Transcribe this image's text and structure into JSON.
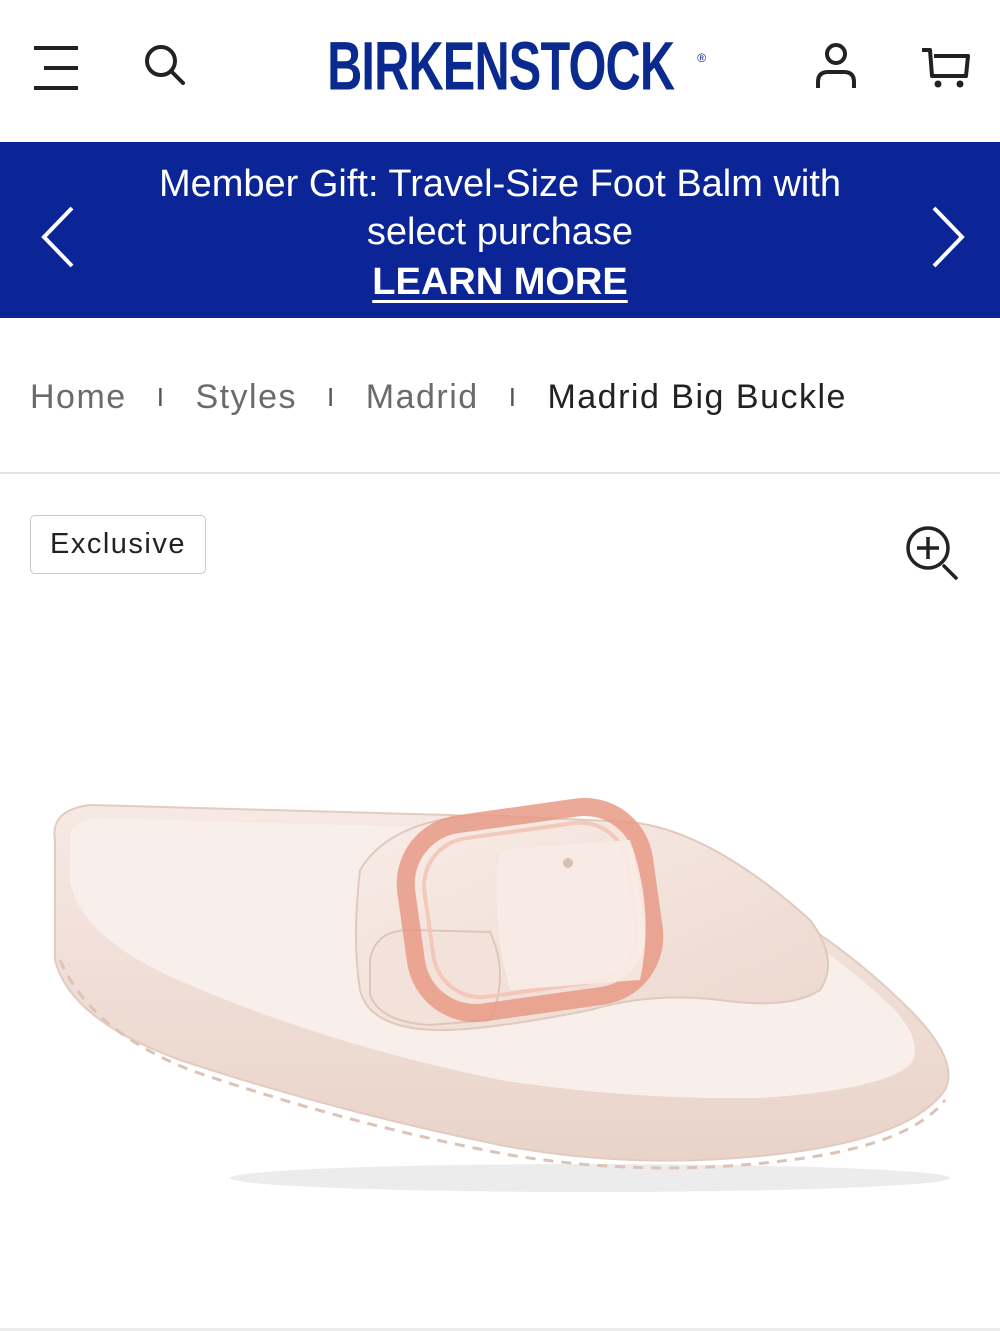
{
  "header": {
    "brand": "BIRKENSTOCK",
    "registered_mark": "®",
    "icons": [
      "menu-icon",
      "search-icon",
      "account-icon",
      "cart-icon"
    ]
  },
  "promo": {
    "message": "Member Gift: Travel-Size Foot Balm with select purchase",
    "link_label": "LEARN MORE",
    "background_color": "#0b2596",
    "icons": [
      "chevron-left-icon",
      "chevron-right-icon"
    ]
  },
  "breadcrumb": {
    "items": [
      "Home",
      "Styles",
      "Madrid",
      "Madrid Big Buckle"
    ],
    "separator": "I"
  },
  "product": {
    "badge": "Exclusive",
    "image_alt_icon": "sandal-image",
    "zoom_icon": "zoom-in-icon"
  },
  "colors": {
    "brand_blue": "#0b2a8f",
    "sandal_color": "#f3e2da",
    "buckle_color": "#e89a86"
  }
}
